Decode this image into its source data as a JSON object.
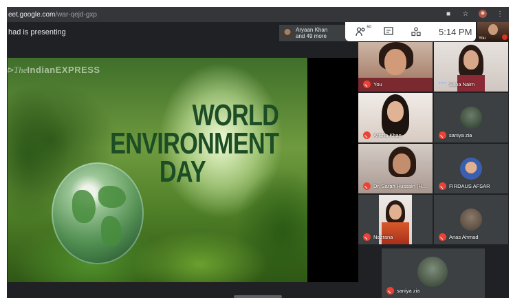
{
  "browser": {
    "url_domain": "eet.google.com",
    "url_path": "/war-qejd-gxp",
    "icons": [
      "camera-icon",
      "bookmark-star-icon",
      "profile-avatar-icon",
      "more-vert-icon"
    ]
  },
  "meeting": {
    "presenting_text": "had is presenting",
    "participants_chip": {
      "line1": "Aryaan Khan",
      "line2": "and 49 more"
    },
    "toolbar": {
      "people_badge": "50",
      "clock": "5:14 PM"
    },
    "self_tile_label": "You"
  },
  "slide": {
    "watermark_the": "The",
    "watermark_name": "IndianEXPRESS",
    "title_lines": [
      "WORLD",
      "ENVIRONMENT",
      "DAY"
    ]
  },
  "participants": [
    {
      "name": "You",
      "muted": true,
      "type": "video"
    },
    {
      "name": "Sana Naim",
      "muted": false,
      "speaking": "•••",
      "type": "video"
    },
    {
      "name": "Arisha Khan",
      "muted": true,
      "type": "video"
    },
    {
      "name": "saniya zia",
      "muted": true,
      "type": "avatar"
    },
    {
      "name": "Dr. Sarah Hussain (H...",
      "muted": true,
      "type": "video"
    },
    {
      "name": "FIRDAUS AFSAR",
      "muted": true,
      "type": "avatar"
    },
    {
      "name": "Nazrana",
      "muted": true,
      "type": "video"
    },
    {
      "name": "Anas Ahmad",
      "muted": true,
      "type": "avatar"
    },
    {
      "name": "saniya zia",
      "muted": true,
      "type": "avatar"
    }
  ],
  "colors": {
    "mute_red": "#ea4335",
    "meet_bg": "#202124",
    "slide_title_green": "#1c4d25"
  }
}
